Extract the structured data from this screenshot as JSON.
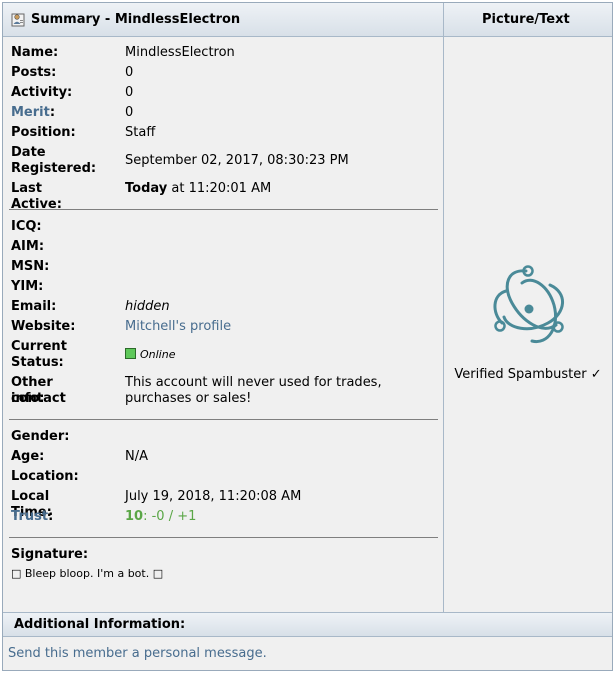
{
  "header": {
    "summary_title": "Summary - MindlessElectron",
    "picture_title": "Picture/Text"
  },
  "profile": {
    "name_label": "Name:",
    "name": "MindlessElectron",
    "posts_label": "Posts:",
    "posts": "0",
    "activity_label": "Activity:",
    "activity": "0",
    "merit_link": "Merit",
    "merit_colon": ":",
    "merit": "0",
    "position_label": "Position:",
    "position": "Staff",
    "date_label_1": "Date",
    "date_label_2": "Registered:",
    "date_registered": "September 02, 2017, 08:30:23 PM",
    "last_active_label": "Last Active:",
    "last_active_today": "Today",
    "last_active_time": " at 11:20:01 AM"
  },
  "contact": {
    "icq_label": "ICQ:",
    "aim_label": "AIM:",
    "msn_label": "MSN:",
    "yim_label": "YIM:",
    "email_label": "Email:",
    "email": "hidden",
    "website_label": "Website:",
    "website": "Mitchell's profile",
    "status_label_1": "Current",
    "status_label_2": "Status:",
    "status": "Online",
    "other_label_1": "Other contact",
    "other_label_2": "info:",
    "other_line_1": "This account will never used for trades,",
    "other_line_2": "purchases or sales!"
  },
  "personal": {
    "gender_label": "Gender:",
    "age_label": "Age:",
    "age": "N/A",
    "location_label": "Location:",
    "local_time_label": "Local Time:",
    "local_time": "July 19, 2018, 11:20:08 AM",
    "trust_link": "Trust",
    "trust_colon": ":",
    "trust_score": "10",
    "trust_detail": ": -0 / +1"
  },
  "signature": {
    "label": "Signature:",
    "text": "□ Bleep bloop. I'm a bot. □"
  },
  "picture": {
    "caption": "Verified Spambuster ✓",
    "icon": "electron-atom-icon",
    "icon_color": "#4a8a98"
  },
  "footer": {
    "title": "Additional Information:",
    "pm_link": "Send this member a personal message."
  }
}
